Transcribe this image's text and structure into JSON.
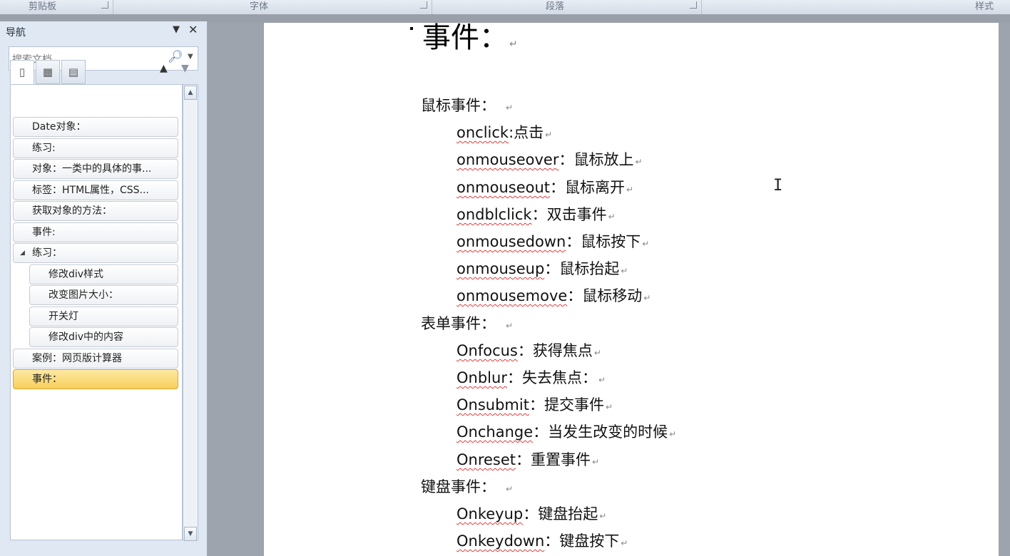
{
  "ribbon": {
    "groups": [
      "剪贴板",
      "字体",
      "段落",
      "样式"
    ]
  },
  "nav": {
    "title": "导航",
    "dropdown_glyph": "▼",
    "close_glyph": "✕",
    "search_placeholder": "搜索文档",
    "search_icon": "magnifier-icon",
    "tabs": [
      "headings-view-icon",
      "pages-view-icon",
      "results-view-icon"
    ],
    "items": [
      {
        "label": "Date对象：",
        "level": 1
      },
      {
        "label": "练习:",
        "level": 1
      },
      {
        "label": "对象：一类中的具体的事...",
        "level": 1
      },
      {
        "label": "标签：HTML属性，CSS...",
        "level": 1
      },
      {
        "label": "获取对象的方法：",
        "level": 1
      },
      {
        "label": "事件:",
        "level": 1
      },
      {
        "label": "练习：",
        "level": 1,
        "expanded": true
      },
      {
        "label": "修改div样式",
        "level": 2
      },
      {
        "label": "改变图片大小：",
        "level": 2
      },
      {
        "label": "开关灯",
        "level": 2
      },
      {
        "label": "修改div中的内容",
        "level": 2
      },
      {
        "label": "案例：网页版计算器",
        "level": 1
      },
      {
        "label": "事件：",
        "level": 1,
        "selected": true
      }
    ]
  },
  "document": {
    "heading": "事件：",
    "para_mark": "↵",
    "sections": [
      {
        "title": "鼠标事件：",
        "items": [
          {
            "event": "onclick",
            "sep": ":",
            "desc": "点击"
          },
          {
            "event": "onmouseover",
            "sep": "：",
            "desc": "鼠标放上"
          },
          {
            "event": "onmouseout",
            "sep": "：",
            "desc": "鼠标离开"
          },
          {
            "event": "ondblclick",
            "sep": "：",
            "desc": "双击事件"
          },
          {
            "event": "onmousedown",
            "sep": "：",
            "desc": "鼠标按下"
          },
          {
            "event": "onmouseup",
            "sep": "：",
            "desc": "鼠标抬起"
          },
          {
            "event": "onmousemove",
            "sep": "：",
            "desc": "鼠标移动"
          }
        ]
      },
      {
        "title": "表单事件：",
        "items": [
          {
            "event": "Onfocus",
            "sep": "：",
            "desc": "获得焦点"
          },
          {
            "event": "Onblur",
            "sep": "：",
            "desc": "失去焦点："
          },
          {
            "event": "Onsubmit",
            "sep": "：",
            "desc": "提交事件"
          },
          {
            "event": "Onchange",
            "sep": "：",
            "desc": "当发生改变的时候"
          },
          {
            "event": "Onreset",
            "sep": "：",
            "desc": "重置事件"
          }
        ]
      },
      {
        "title": "键盘事件：",
        "items": [
          {
            "event": "Onkeyup",
            "sep": "：",
            "desc": "键盘抬起"
          },
          {
            "event": "Onkeydown",
            "sep": "：",
            "desc": "键盘按下"
          }
        ]
      }
    ]
  }
}
